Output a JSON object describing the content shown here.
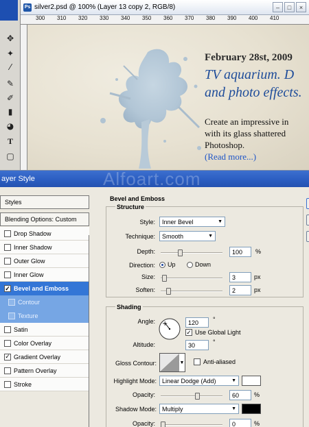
{
  "document": {
    "title": "silver2.psd @ 100% (Layer 13 copy 2, RGB/8)",
    "app_icon": "Ps",
    "ruler_ticks": [
      "300",
      "310",
      "320",
      "330",
      "340",
      "350",
      "360",
      "370",
      "380",
      "390",
      "400",
      "410"
    ]
  },
  "blog": {
    "date": "February 28st, 2009",
    "title_line1": "TV aquarium. D",
    "title_line2": "and photo effects.",
    "body_line1": "Create an impressive in",
    "body_line2": "with its glass shattered",
    "body_line3": "Photoshop.",
    "read_more": "(Read more...)"
  },
  "dialog": {
    "title": "ayer Style",
    "watermark": "Alfoart.com",
    "styles_label": "Styles",
    "blending_label": "Blending Options: Custom",
    "effects": [
      {
        "label": "Drop Shadow",
        "checked": false
      },
      {
        "label": "Inner Shadow",
        "checked": false
      },
      {
        "label": "Outer Glow",
        "checked": false
      },
      {
        "label": "Inner Glow",
        "checked": false
      },
      {
        "label": "Bevel and Emboss",
        "checked": true
      },
      {
        "label": "Contour",
        "checked": false
      },
      {
        "label": "Texture",
        "checked": false
      },
      {
        "label": "Satin",
        "checked": false
      },
      {
        "label": "Color Overlay",
        "checked": false
      },
      {
        "label": "Gradient Overlay",
        "checked": true
      },
      {
        "label": "Pattern Overlay",
        "checked": false
      },
      {
        "label": "Stroke",
        "checked": false
      }
    ]
  },
  "bevel": {
    "heading": "Bevel and Emboss",
    "structure_heading": "Structure",
    "style_label": "Style:",
    "style_value": "Inner Bevel",
    "technique_label": "Technique:",
    "technique_value": "Smooth",
    "depth_label": "Depth:",
    "depth_value": "100",
    "depth_unit": "%",
    "direction_label": "Direction:",
    "direction_up": "Up",
    "direction_down": "Down",
    "size_label": "Size:",
    "size_value": "3",
    "size_unit": "px",
    "soften_label": "Soften:",
    "soften_value": "2",
    "soften_unit": "px"
  },
  "shading": {
    "heading": "Shading",
    "angle_label": "Angle:",
    "angle_value": "120",
    "angle_unit": "°",
    "global_light_label": "Use Global Light",
    "global_light_checked": true,
    "altitude_label": "Altitude:",
    "altitude_value": "30",
    "altitude_unit": "°",
    "gloss_label": "Gloss Contour:",
    "anti_aliased_label": "Anti-aliased",
    "highlight_mode_label": "Highlight Mode:",
    "highlight_mode_value": "Linear Dodge (Add)",
    "highlight_color": "#ffffff",
    "highlight_opacity_label": "Opacity:",
    "highlight_opacity_value": "60",
    "shadow_mode_label": "Shadow Mode:",
    "shadow_mode_value": "Multiply",
    "shadow_color": "#000000",
    "shadow_opacity_label": "Opacity:",
    "shadow_opacity_value": "0",
    "percent": "%"
  },
  "levels": {
    "depth_slider": 0.3,
    "size_slider": 0.03,
    "soften_slider": 0.1,
    "highlight_opacity_slider": 0.6,
    "shadow_opacity_slider": 0.0
  },
  "colors": {
    "selection": "#3476d6",
    "title_bar": "#2a5cc0",
    "link": "#1f56c8",
    "blog_title": "#1f4d9a"
  }
}
